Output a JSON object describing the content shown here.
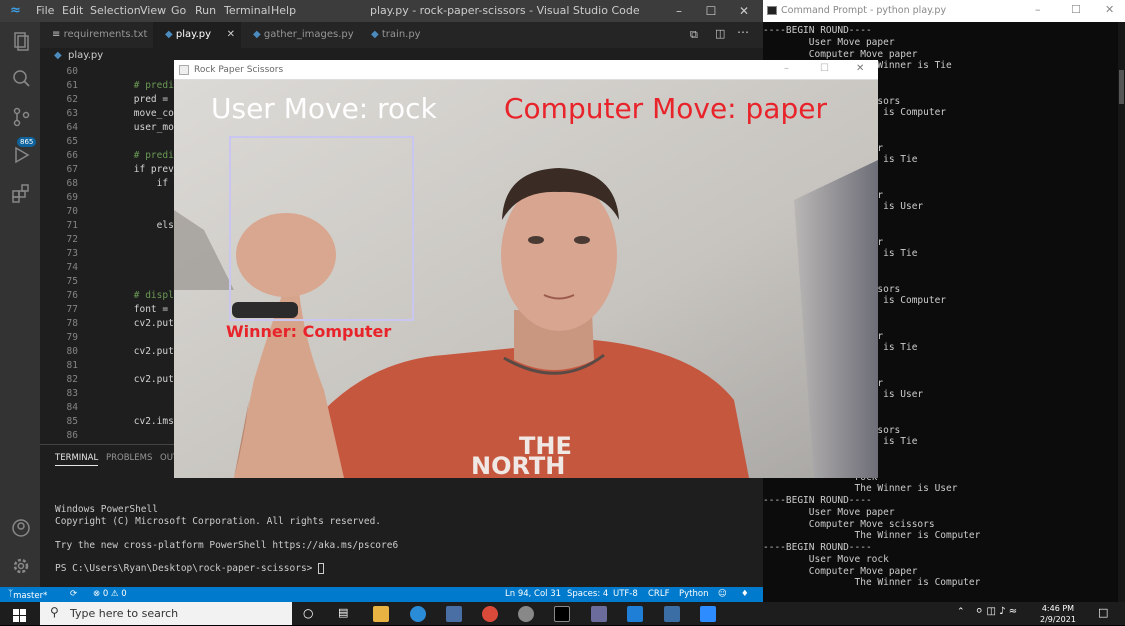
{
  "vscode": {
    "menu": [
      "File",
      "Edit",
      "Selection",
      "View",
      "Go",
      "Run",
      "Terminal",
      "Help"
    ],
    "title": "play.py - rock-paper-scissors - Visual Studio Code",
    "tabs": [
      "requirements.txt",
      "play.py",
      "gather_images.py",
      "train.py"
    ],
    "breadcrumb": "play.py",
    "source_control_badge": "865",
    "lines": [
      {
        "n": "60",
        "t": ""
      },
      {
        "n": "61",
        "t": "        # predict t"
      },
      {
        "n": "62",
        "t": "        pred = mode"
      },
      {
        "n": "63",
        "t": "        move_code ="
      },
      {
        "n": "64",
        "t": "        user_move_n"
      },
      {
        "n": "65",
        "t": ""
      },
      {
        "n": "66",
        "t": "        # predict t"
      },
      {
        "n": "67",
        "t": "        if prev_mov"
      },
      {
        "n": "68",
        "t": "            if user"
      },
      {
        "n": "69",
        "t": "                com"
      },
      {
        "n": "70",
        "t": "                win"
      },
      {
        "n": "71",
        "t": "            else:"
      },
      {
        "n": "72",
        "t": "                com"
      },
      {
        "n": "73",
        "t": "                win"
      },
      {
        "n": "74",
        "t": ""
      },
      {
        "n": "75",
        "t": ""
      },
      {
        "n": "76",
        "t": "        # display t"
      },
      {
        "n": "77",
        "t": "        font = cv2."
      },
      {
        "n": "78",
        "t": "        cv2.putText"
      },
      {
        "n": "79",
        "t": ""
      },
      {
        "n": "80",
        "t": "        cv2.putText"
      },
      {
        "n": "81",
        "t": ""
      },
      {
        "n": "82",
        "t": "        cv2.putText"
      },
      {
        "n": "83",
        "t": ""
      },
      {
        "n": "84",
        "t": ""
      },
      {
        "n": "85",
        "t": "        cv2.imshow("
      },
      {
        "n": "86",
        "t": ""
      }
    ],
    "panel_tabs": [
      "TERMINAL",
      "PROBLEMS",
      "OUT"
    ],
    "terminal": [
      "Windows PowerShell",
      "Copyright (C) Microsoft Corporation. All rights reserved.",
      "",
      "Try the new cross-platform PowerShell https://aka.ms/pscore6",
      "",
      "PS C:\\Users\\Ryan\\Desktop\\rock-paper-scissors> "
    ],
    "status": {
      "branch": "master*",
      "problems": "⊗ 0 ⚠ 0",
      "position": "Ln 94, Col 31",
      "spaces": "Spaces: 4",
      "encoding": "UTF-8",
      "eol": "CRLF",
      "language": "Python"
    }
  },
  "cmd": {
    "title": "Command Prompt - python  play.py",
    "lines": [
      "----BEGIN ROUND----",
      "        User Move paper",
      "        Computer Move paper",
      "                The Winner is Tie",
      "",
      "                r",
      "                scissors",
      "                nner is Computer",
      "",
      "                r",
      "                paper",
      "                nner is Tie",
      "",
      "                sors",
      "                paper",
      "                nner is User",
      "",
      "                r",
      "                paper",
      "                nner is Tie",
      "",
      "                r",
      "                scissors",
      "                nner is Computer",
      "",
      "                r",
      "                paper",
      "                nner is Tie",
      "",
      "                sors",
      "                paper",
      "                nner is User",
      "",
      "                sors",
      "                scissors",
      "                nner is Tie",
      "",
      "                r",
      "                rock",
      "                The Winner is User",
      "----BEGIN ROUND----",
      "        User Move paper",
      "        Computer Move scissors",
      "                The Winner is Computer",
      "----BEGIN ROUND----",
      "        User Move rock",
      "        Computer Move paper",
      "                The Winner is Computer"
    ]
  },
  "rps": {
    "title": "Rock Paper Scissors",
    "user_move": "User Move: rock",
    "computer_move": "Computer Move: paper",
    "winner": "Winner: Computer",
    "shirt_text_1": "THE",
    "shirt_text_2": "NORTH"
  },
  "taskbar": {
    "search_placeholder": "Type here to search",
    "time": "4:46 PM",
    "date": "2/9/2021"
  },
  "colors": {
    "vs_status": "#007acc",
    "computer_move_red": "#e8232a",
    "user_move_white": "#ffffff",
    "box_border": "#c9c6f2"
  }
}
